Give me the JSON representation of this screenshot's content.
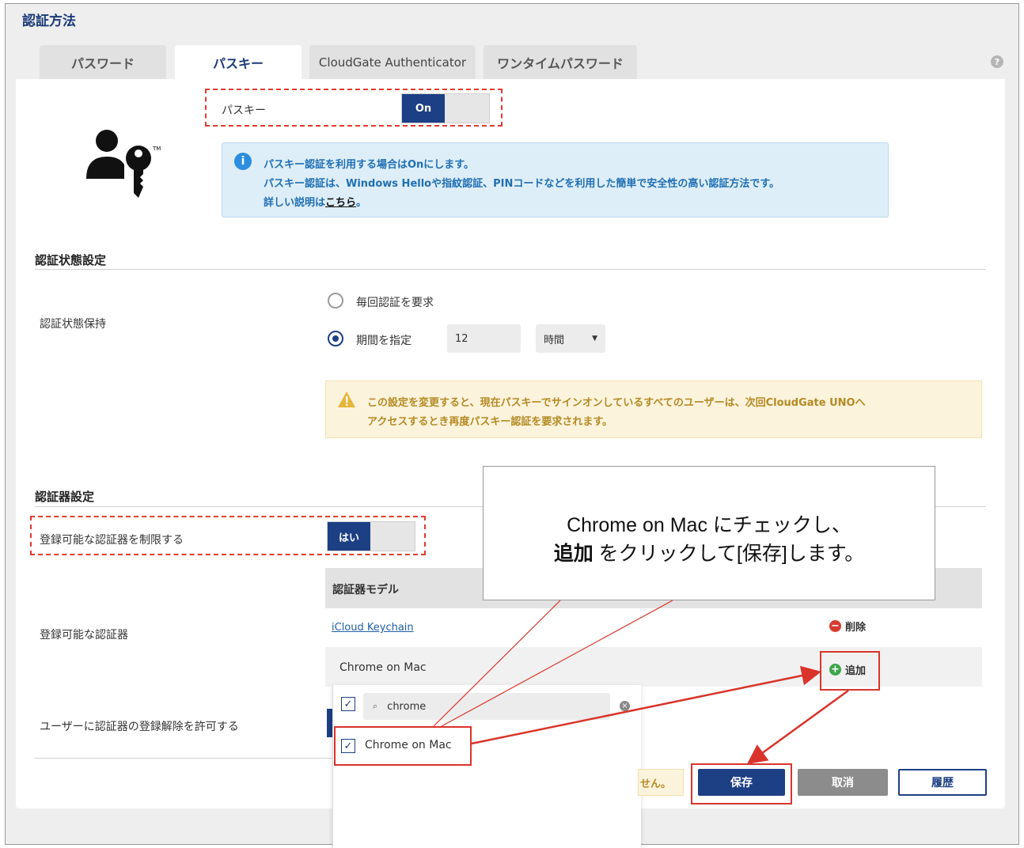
{
  "page_title": "認証方法",
  "tabs": [
    {
      "label": "パスワード",
      "active": false
    },
    {
      "label": "パスキー",
      "active": true
    },
    {
      "label": "CloudGate Authenticator",
      "active": false
    },
    {
      "label": "ワンタイムパスワード",
      "active": false
    }
  ],
  "help_icon": "?",
  "passkey": {
    "label": "パスキー",
    "toggle": "On",
    "info": {
      "line1": "パスキー認証を利用する場合はOnにします。",
      "line2": "パスキー認証は、Windows Helloや指紋認証、PINコードなどを利用した簡単で安全性の高い認証方法です。",
      "line3_prefix": "詳しい説明は",
      "line3_link": "こちら",
      "line3_suffix": "。"
    }
  },
  "auth_state": {
    "section_title": "認証状態設定",
    "keep_label": "認証状態保持",
    "option_every": "毎回認証を要求",
    "option_period": "期間を指定",
    "period_value": "12",
    "period_unit": "時間",
    "warning_line1": "この設定を変更すると、現在パスキーでサインオンしているすべてのユーザーは、次回CloudGate UNOへ",
    "warning_line2": "アクセスするとき再度パスキー認証を要求されます。"
  },
  "authenticator": {
    "section_title": "認証器設定",
    "restrict_label": "登録可能な認証器を制限する",
    "restrict_toggle": "はい",
    "registrable_label": "登録可能な認証器",
    "table_header": "認証器モデル",
    "rows": [
      {
        "name": "iCloud Keychain",
        "action": "削除"
      },
      {
        "name": "Chrome on Mac",
        "action": "追加"
      }
    ],
    "search_value": "chrome",
    "dropdown_option": "Chrome on Mac",
    "allow_unregister_label": "ユーザーに認証器の登録解除を許可する"
  },
  "footer": {
    "notice_tail": "せん。",
    "save": "保存",
    "cancel": "取消",
    "history": "履歴"
  },
  "callout": {
    "line1": "Chrome on Mac にチェックし、",
    "line2_bold": "追加",
    "line2_rest": " をクリックして[保存]します。"
  },
  "colors": {
    "brand_blue": "#1d3f84",
    "annotation_red": "#d9342b",
    "info_blue": "#1f6fb4",
    "warning_text": "#b58a24"
  }
}
